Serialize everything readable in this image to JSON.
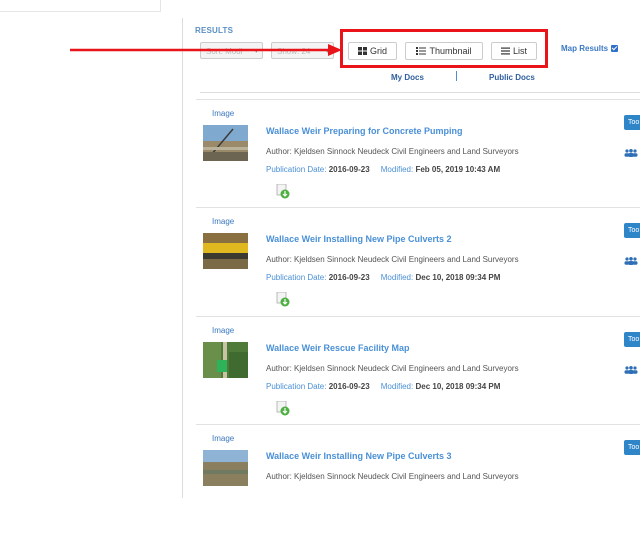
{
  "results_label": "RESULTS",
  "controls": {
    "sort_label": "Sort: Modi",
    "show_label": "Show: 24",
    "grid_label": "Grid",
    "thumbnail_label": "Thumbnail",
    "list_label": "List",
    "map_results_label": "Map Results",
    "map_results_checked": true
  },
  "doc_tabs": {
    "my_docs": "My Docs",
    "public_docs": "Public Docs"
  },
  "labels": {
    "publication_date": "Publication Date:",
    "modified": "Modified:",
    "tool_button": "Too"
  },
  "results": [
    {
      "type": "Image",
      "title": "Wallace Weir Preparing for Concrete Pumping",
      "author": "Author: Kjeldsen Sinnock Neudeck Civil Engineers and Land Surveyors",
      "publication_date": "2016-09-23",
      "modified": "Feb 05, 2019 10:43 AM"
    },
    {
      "type": "Image",
      "title": "Wallace Weir Installing New Pipe Culverts 2",
      "author": "Author: Kjeldsen Sinnock Neudeck Civil Engineers and Land Surveyors",
      "publication_date": "2016-09-23",
      "modified": "Dec 10, 2018 09:34 PM"
    },
    {
      "type": "Image",
      "title": "Wallace Weir Rescue Facility Map",
      "author": "Author: Kjeldsen Sinnock Neudeck Civil Engineers and Land Surveyors",
      "publication_date": "2016-09-23",
      "modified": "Dec 10, 2018 09:34 PM"
    },
    {
      "type": "Image",
      "title": "Wallace Weir Installing New Pipe Culverts 3",
      "author": "Author: Kjeldsen Sinnock Neudeck Civil Engineers and Land Surveyors",
      "publication_date": "",
      "modified": ""
    }
  ],
  "colors": {
    "accent": "#4a90d6",
    "annotation_red": "#e8141a",
    "tool_button": "#2e86c9"
  },
  "icons": {
    "grid": "grid-icon",
    "thumbnail": "thumbnail-icon",
    "list": "list-icon",
    "download": "download-icon",
    "group": "group-icon"
  }
}
